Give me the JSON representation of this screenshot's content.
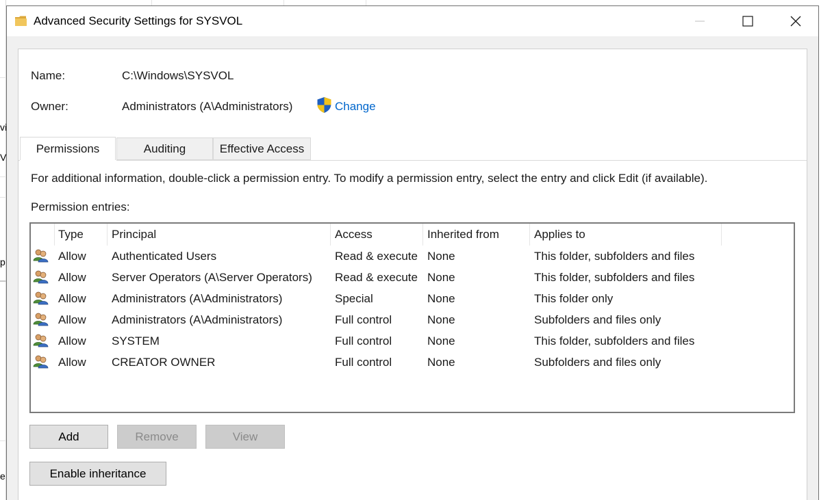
{
  "window": {
    "title": "Advanced Security Settings for SYSVOL",
    "folder_color": "#e8b84a"
  },
  "info": {
    "name_label": "Name:",
    "name_value": "C:\\Windows\\SYSVOL",
    "owner_label": "Owner:",
    "owner_value": "Administrators (A\\Administrators)",
    "change_link": "Change"
  },
  "tabs": [
    {
      "label": "Permissions",
      "active": true
    },
    {
      "label": "Auditing",
      "active": false
    },
    {
      "label": "Effective Access",
      "active": false
    }
  ],
  "instructions": "For additional information, double-click a permission entry. To modify a permission entry, select the entry and click Edit (if available).",
  "entries_label": "Permission entries:",
  "table": {
    "columns": [
      "Type",
      "Principal",
      "Access",
      "Inherited from",
      "Applies to"
    ],
    "rows": [
      {
        "type": "Allow",
        "principal": "Authenticated Users",
        "access": "Read & execute",
        "inherited": "None",
        "applies": "This folder, subfolders and files"
      },
      {
        "type": "Allow",
        "principal": "Server Operators (A\\Server Operators)",
        "access": "Read & execute",
        "inherited": "None",
        "applies": "This folder, subfolders and files"
      },
      {
        "type": "Allow",
        "principal": "Administrators (A\\Administrators)",
        "access": "Special",
        "inherited": "None",
        "applies": "This folder only"
      },
      {
        "type": "Allow",
        "principal": "Administrators (A\\Administrators)",
        "access": "Full control",
        "inherited": "None",
        "applies": "Subfolders and files only"
      },
      {
        "type": "Allow",
        "principal": "SYSTEM",
        "access": "Full control",
        "inherited": "None",
        "applies": "This folder, subfolders and files"
      },
      {
        "type": "Allow",
        "principal": "CREATOR OWNER",
        "access": "Full control",
        "inherited": "None",
        "applies": "Subfolders and files only"
      }
    ]
  },
  "buttons": {
    "add": "Add",
    "remove": "Remove",
    "view": "View",
    "enable_inheritance": "Enable inheritance"
  },
  "icons": {
    "title": "folder-icon",
    "owner_change": "uac-shield-icon",
    "row": "users-group-icon"
  },
  "colors": {
    "link": "#0066cc",
    "shield_blue": "#1f5fbf",
    "shield_yellow": "#f2c21b"
  }
}
